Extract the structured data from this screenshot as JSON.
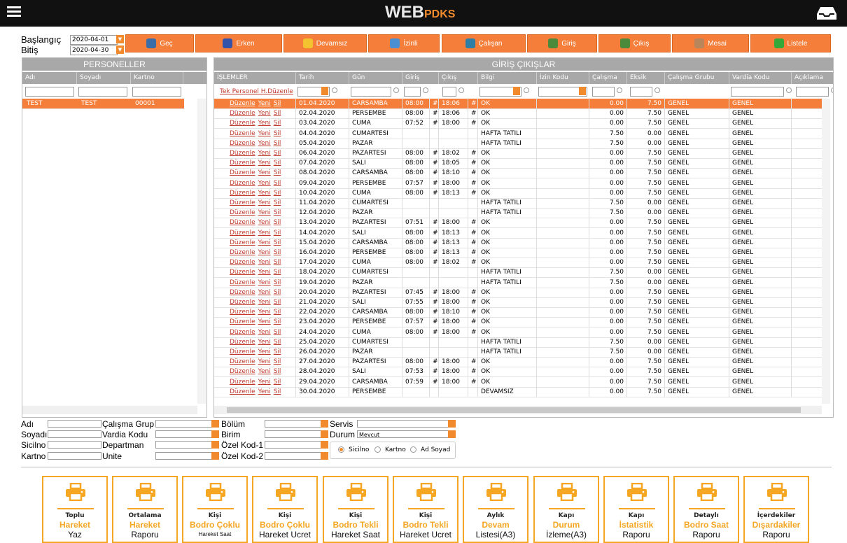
{
  "header": {
    "logo_main": "WEB",
    "logo_sub": "PDKS"
  },
  "dates": {
    "start_label": "Başlangıç",
    "start_value": "2020-04-01",
    "end_label": "Bitiş",
    "end_value": "2020-04-30"
  },
  "toolbar": [
    {
      "label": "Geç",
      "color": "#3b6ea8"
    },
    {
      "label": "Erken",
      "color": "#3553a8"
    },
    {
      "label": "Devamsız",
      "color": "#f2c230"
    },
    {
      "label": "İzinli",
      "color": "#4a8fd1"
    },
    {
      "label": "Çalışan",
      "color": "#2f7ea6"
    },
    {
      "label": "Giriş",
      "color": "#4a8a3a"
    },
    {
      "label": "Çıkış",
      "color": "#4a8a3a"
    },
    {
      "label": "Mesai",
      "color": "#b8865a"
    },
    {
      "label": "Listele",
      "color": "#36a83a"
    }
  ],
  "left_panel": {
    "title": "PERSONELLER",
    "columns": [
      "Adı",
      "Soyadı",
      "Kartno"
    ],
    "rows": [
      [
        "TEST",
        "TEST",
        "00001"
      ]
    ]
  },
  "main_panel": {
    "title": "GİRİŞ ÇIKIŞLAR",
    "columns": [
      "İŞLEMLER",
      "Tarih",
      "Gün",
      "Giriş",
      "Çıkış",
      "Bilgi",
      "İzin Kodu",
      "Çalışma",
      "Eksik",
      "Çalışma Grubu",
      "Vardia Kodu",
      "Açıklama"
    ],
    "tek_personel_link": "Tek Personel H.Düzenle",
    "action_labels": [
      "Düzenle",
      "Yeni",
      "Sil"
    ],
    "rows": [
      {
        "date": "01.04.2020",
        "day": "CARSAMBA",
        "in": "08:00",
        "in_m": "#",
        "out": "18:06",
        "out_m": "#",
        "info": "OK",
        "work": "0.00",
        "missing": "7.50",
        "group": "GENEL",
        "shift": "GENEL"
      },
      {
        "date": "02.04.2020",
        "day": "PERSEMBE",
        "in": "08:00",
        "in_m": "#",
        "out": "18:06",
        "out_m": "#",
        "info": "OK",
        "work": "0.00",
        "missing": "7.50",
        "group": "GENEL",
        "shift": "GENEL"
      },
      {
        "date": "03.04.2020",
        "day": "CUMA",
        "in": "07:52",
        "in_m": "#",
        "out": "18:00",
        "out_m": "#",
        "info": "OK",
        "work": "0.00",
        "missing": "7.50",
        "group": "GENEL",
        "shift": "GENEL"
      },
      {
        "date": "04.04.2020",
        "day": "CUMARTESI",
        "in": "",
        "in_m": "",
        "out": "",
        "out_m": "",
        "info": "HAFTA TATILI",
        "work": "7.50",
        "missing": "0.00",
        "group": "GENEL",
        "shift": "GENEL"
      },
      {
        "date": "05.04.2020",
        "day": "PAZAR",
        "in": "",
        "in_m": "",
        "out": "",
        "out_m": "",
        "info": "HAFTA TATILI",
        "work": "7.50",
        "missing": "0.00",
        "group": "GENEL",
        "shift": "GENEL"
      },
      {
        "date": "06.04.2020",
        "day": "PAZARTESI",
        "in": "08:00",
        "in_m": "#",
        "out": "18:02",
        "out_m": "#",
        "info": "OK",
        "work": "0.00",
        "missing": "7.50",
        "group": "GENEL",
        "shift": "GENEL"
      },
      {
        "date": "07.04.2020",
        "day": "SALI",
        "in": "08:00",
        "in_m": "#",
        "out": "18:05",
        "out_m": "#",
        "info": "OK",
        "work": "0.00",
        "missing": "7.50",
        "group": "GENEL",
        "shift": "GENEL"
      },
      {
        "date": "08.04.2020",
        "day": "CARSAMBA",
        "in": "08:00",
        "in_m": "#",
        "out": "18:10",
        "out_m": "#",
        "info": "OK",
        "work": "0.00",
        "missing": "7.50",
        "group": "GENEL",
        "shift": "GENEL"
      },
      {
        "date": "09.04.2020",
        "day": "PERSEMBE",
        "in": "07:57",
        "in_m": "#",
        "out": "18:00",
        "out_m": "#",
        "info": "OK",
        "work": "0.00",
        "missing": "7.50",
        "group": "GENEL",
        "shift": "GENEL"
      },
      {
        "date": "10.04.2020",
        "day": "CUMA",
        "in": "08:00",
        "in_m": "#",
        "out": "18:13",
        "out_m": "#",
        "info": "OK",
        "work": "0.00",
        "missing": "7.50",
        "group": "GENEL",
        "shift": "GENEL"
      },
      {
        "date": "11.04.2020",
        "day": "CUMARTESI",
        "in": "",
        "in_m": "",
        "out": "",
        "out_m": "",
        "info": "HAFTA TATILI",
        "work": "7.50",
        "missing": "0.00",
        "group": "GENEL",
        "shift": "GENEL"
      },
      {
        "date": "12.04.2020",
        "day": "PAZAR",
        "in": "",
        "in_m": "",
        "out": "",
        "out_m": "",
        "info": "HAFTA TATILI",
        "work": "7.50",
        "missing": "0.00",
        "group": "GENEL",
        "shift": "GENEL"
      },
      {
        "date": "13.04.2020",
        "day": "PAZARTESI",
        "in": "07:51",
        "in_m": "#",
        "out": "18:00",
        "out_m": "#",
        "info": "OK",
        "work": "0.00",
        "missing": "7.50",
        "group": "GENEL",
        "shift": "GENEL"
      },
      {
        "date": "14.04.2020",
        "day": "SALI",
        "in": "08:00",
        "in_m": "#",
        "out": "18:13",
        "out_m": "#",
        "info": "OK",
        "work": "0.00",
        "missing": "7.50",
        "group": "GENEL",
        "shift": "GENEL"
      },
      {
        "date": "15.04.2020",
        "day": "CARSAMBA",
        "in": "08:00",
        "in_m": "#",
        "out": "18:13",
        "out_m": "#",
        "info": "OK",
        "work": "0.00",
        "missing": "7.50",
        "group": "GENEL",
        "shift": "GENEL"
      },
      {
        "date": "16.04.2020",
        "day": "PERSEMBE",
        "in": "08:00",
        "in_m": "#",
        "out": "18:13",
        "out_m": "#",
        "info": "OK",
        "work": "0.00",
        "missing": "7.50",
        "group": "GENEL",
        "shift": "GENEL"
      },
      {
        "date": "17.04.2020",
        "day": "CUMA",
        "in": "08:00",
        "in_m": "#",
        "out": "18:02",
        "out_m": "#",
        "info": "OK",
        "work": "0.00",
        "missing": "7.50",
        "group": "GENEL",
        "shift": "GENEL"
      },
      {
        "date": "18.04.2020",
        "day": "CUMARTESI",
        "in": "",
        "in_m": "",
        "out": "",
        "out_m": "",
        "info": "HAFTA TATILI",
        "work": "7.50",
        "missing": "0.00",
        "group": "GENEL",
        "shift": "GENEL"
      },
      {
        "date": "19.04.2020",
        "day": "PAZAR",
        "in": "",
        "in_m": "",
        "out": "",
        "out_m": "",
        "info": "HAFTA TATILI",
        "work": "7.50",
        "missing": "0.00",
        "group": "GENEL",
        "shift": "GENEL"
      },
      {
        "date": "20.04.2020",
        "day": "PAZARTESI",
        "in": "07:45",
        "in_m": "#",
        "out": "18:00",
        "out_m": "#",
        "info": "OK",
        "work": "0.00",
        "missing": "7.50",
        "group": "GENEL",
        "shift": "GENEL"
      },
      {
        "date": "21.04.2020",
        "day": "SALI",
        "in": "07:55",
        "in_m": "#",
        "out": "18:00",
        "out_m": "#",
        "info": "OK",
        "work": "0.00",
        "missing": "7.50",
        "group": "GENEL",
        "shift": "GENEL"
      },
      {
        "date": "22.04.2020",
        "day": "CARSAMBA",
        "in": "08:00",
        "in_m": "#",
        "out": "18:10",
        "out_m": "#",
        "info": "OK",
        "work": "0.00",
        "missing": "7.50",
        "group": "GENEL",
        "shift": "GENEL"
      },
      {
        "date": "23.04.2020",
        "day": "PERSEMBE",
        "in": "07:57",
        "in_m": "#",
        "out": "18:00",
        "out_m": "#",
        "info": "OK",
        "work": "0.00",
        "missing": "7.50",
        "group": "GENEL",
        "shift": "GENEL"
      },
      {
        "date": "24.04.2020",
        "day": "CUMA",
        "in": "08:00",
        "in_m": "#",
        "out": "18:00",
        "out_m": "#",
        "info": "OK",
        "work": "0.00",
        "missing": "7.50",
        "group": "GENEL",
        "shift": "GENEL"
      },
      {
        "date": "25.04.2020",
        "day": "CUMARTESI",
        "in": "",
        "in_m": "",
        "out": "",
        "out_m": "",
        "info": "HAFTA TATILI",
        "work": "7.50",
        "missing": "0.00",
        "group": "GENEL",
        "shift": "GENEL"
      },
      {
        "date": "26.04.2020",
        "day": "PAZAR",
        "in": "",
        "in_m": "",
        "out": "",
        "out_m": "",
        "info": "HAFTA TATILI",
        "work": "7.50",
        "missing": "0.00",
        "group": "GENEL",
        "shift": "GENEL"
      },
      {
        "date": "27.04.2020",
        "day": "PAZARTESI",
        "in": "08:00",
        "in_m": "#",
        "out": "18:00",
        "out_m": "#",
        "info": "OK",
        "work": "0.00",
        "missing": "7.50",
        "group": "GENEL",
        "shift": "GENEL"
      },
      {
        "date": "28.04.2020",
        "day": "SALI",
        "in": "07:53",
        "in_m": "#",
        "out": "18:00",
        "out_m": "#",
        "info": "OK",
        "work": "0.00",
        "missing": "7.50",
        "group": "GENEL",
        "shift": "GENEL"
      },
      {
        "date": "29.04.2020",
        "day": "CARSAMBA",
        "in": "07:59",
        "in_m": "#",
        "out": "18:00",
        "out_m": "#",
        "info": "OK",
        "work": "0.00",
        "missing": "7.50",
        "group": "GENEL",
        "shift": "GENEL"
      },
      {
        "date": "30.04.2020",
        "day": "PERSEMBE",
        "in": "",
        "in_m": "",
        "out": "",
        "out_m": "",
        "info": "DEVAMSIZ",
        "work": "0.00",
        "missing": "7.50",
        "group": "GENEL",
        "shift": "GENEL"
      }
    ]
  },
  "filters": {
    "col1": [
      "Adı",
      "Soyadı",
      "Sicilno",
      "Kartno"
    ],
    "col2": [
      "Çalışma Grup",
      "Vardia Kodu",
      "Departman",
      "Unite"
    ],
    "col3": [
      "Bölüm",
      "Birim",
      "Özel Kod-1",
      "Özel Kod-2"
    ],
    "servis_label": "Servis",
    "durum_label": "Durum",
    "durum_value": "Mevcut",
    "radios": [
      "Sicilno",
      "Kartno",
      "Ad Soyad"
    ]
  },
  "reports": [
    {
      "l1": "Toplu",
      "l2": "Hareket",
      "l3": "Yaz",
      "small": false
    },
    {
      "l1": "Ortalama",
      "l2": "Hareket",
      "l3": "Raporu",
      "small": false
    },
    {
      "l1": "Kişi",
      "l2": "Bodro Çoklu",
      "l3": "Hareket Saat",
      "small": true
    },
    {
      "l1": "Kişi",
      "l2": "Bodro Çoklu",
      "l3": "Hareket Ucret",
      "small": false
    },
    {
      "l1": "Kişi",
      "l2": "Bodro Tekli",
      "l3": "Hareket Saat",
      "small": false
    },
    {
      "l1": "Kişi",
      "l2": "Bodro Tekli",
      "l3": "Hareket Ucret",
      "small": false
    },
    {
      "l1": "Aylık",
      "l2": "Devam",
      "l3": "Listesi(A3)",
      "small": false
    },
    {
      "l1": "Kapı",
      "l2": "Durum",
      "l3": "İzleme(A3)",
      "small": false
    },
    {
      "l1": "Kapı",
      "l2": "İstatistik",
      "l3": "Raporu",
      "small": false
    },
    {
      "l1": "Detaylı",
      "l2": "Bodro Saat",
      "l3": "Raporu",
      "small": false
    },
    {
      "l1": "İçerdekiler",
      "l2": "Dışardakiler",
      "l3": "Raporu",
      "small": false
    }
  ]
}
